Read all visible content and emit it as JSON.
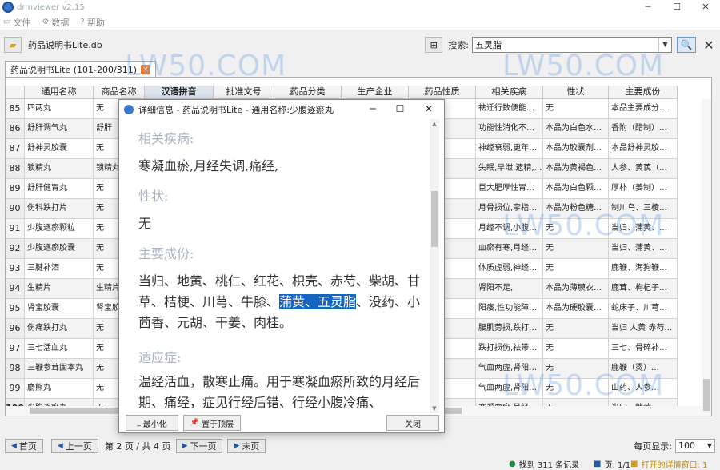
{
  "window": {
    "title": "drmviewer v2.15",
    "minimize": "─",
    "maximize": "☐",
    "close": "✕"
  },
  "menu": [
    {
      "label": "文件",
      "icon": "file-icon"
    },
    {
      "label": "数据",
      "icon": "gear-icon"
    },
    {
      "label": "帮助",
      "icon": "help-icon"
    }
  ],
  "toolbar": {
    "db_name": "药品说明书Lite.db",
    "search_label": "搜索:",
    "search_value": "五灵脂"
  },
  "tab": {
    "label": "药品说明书Lite (101-200/311)",
    "close": "×"
  },
  "watermark": "LW50.COM",
  "grid": {
    "headers": [
      "",
      "通用名称",
      "商品名称",
      "汉语拼音",
      "批准文号",
      "药品分类",
      "生产企业",
      "药品性质",
      "相关疾病",
      "性状",
      "主要成份"
    ],
    "rows": [
      [
        "85",
        "四两丸",
        "无",
        "",
        "",
        "",
        "",
        "方药",
        "祛迁行数便能…",
        "无",
        "本品主要成分…"
      ],
      [
        "86",
        "舒肝调气丸",
        "舒肝",
        "",
        "",
        "",
        "",
        "C甲类",
        "功能性消化不…",
        "本品为白色水…",
        "香附（醋制）…"
      ],
      [
        "87",
        "舒神灵胶囊",
        "无",
        "",
        "",
        "",
        "",
        "C甲类",
        "神经衰弱,更年…",
        "本品为胶囊剂…",
        "本品舒神灵胶…"
      ],
      [
        "88",
        "锁精丸",
        "锁精丸",
        "",
        "",
        "",
        "",
        "C甲类",
        "失眠,早泄,遗精,…",
        "本品为黄褐色…",
        "人参、黄芪（…"
      ],
      [
        "89",
        "舒肝健胃丸",
        "无",
        "",
        "",
        "",
        "",
        "C甲类",
        "巨大肥厚性胃…",
        "本品为白色颗…",
        "厚朴（姜制）…"
      ],
      [
        "90",
        "伤科跌打片",
        "无",
        "",
        "",
        "",
        "",
        "方药",
        "月骨损位,挛指…",
        "本品为粉色糖…",
        "制川乌、三棱…"
      ],
      [
        "91",
        "少腹逐瘀颗粒",
        "无",
        "",
        "",
        "",
        "",
        "方药",
        "月经不调,小腹…",
        "无",
        "当归、蒲黄、…"
      ],
      [
        "92",
        "少腹逐瘀胶囊",
        "无",
        "",
        "",
        "",
        "",
        "方药",
        "血瘀有寒,月经…",
        "无",
        "当归、蒲黄、…"
      ],
      [
        "93",
        "三腱补酒",
        "无",
        "",
        "",
        "",
        "",
        "C甲类",
        "体质虚弱,神经…",
        "无",
        "鹿鞭、海狗鞭…"
      ],
      [
        "94",
        "生精片",
        "生精片",
        "",
        "",
        "",
        "",
        "C甲类",
        "肾阳不足,",
        "本品为薄膜衣…",
        "鹿茸、枸杞子…"
      ],
      [
        "95",
        "肾宝胶囊",
        "肾宝胶",
        "",
        "",
        "",
        "",
        "方药",
        "阳痿,性功能障…",
        "本品为硬胶囊…",
        "蛇床子、川芎…"
      ],
      [
        "96",
        "伤痛跌打丸",
        "无",
        "",
        "",
        "",
        "",
        "C甲类",
        "腰肌劳损,跌打…",
        "无",
        "当归 人黄 赤芍…"
      ],
      [
        "97",
        "三七活血丸",
        "无",
        "",
        "",
        "",
        "",
        "C甲类",
        "跌打损伤,祛带…",
        "无",
        "三七、骨碎补…"
      ],
      [
        "98",
        "三鞭参茸固本丸",
        "无",
        "",
        "",
        "",
        "",
        "C甲类",
        "气血两虚,肾阳…",
        "无",
        "鹿鞭（烫）…"
      ],
      [
        "99",
        "麝熊丸",
        "无",
        "",
        "",
        "",
        "",
        "C甲类",
        "气血两虚,肾阳…",
        "无",
        "山药、人参…"
      ],
      [
        "100",
        "少腹逐瘀丸",
        "无",
        "",
        "",
        "",
        "",
        "C甲类",
        "寒凝血瘀,月经…",
        "无",
        "当归、地黄、…"
      ]
    ]
  },
  "pager": {
    "first": "首页",
    "prev": "上一页",
    "info": "第 2 页 / 共 4 页",
    "next": "下一页",
    "last": "末页",
    "per_page_label": "每页显示:",
    "per_page": "100"
  },
  "status": {
    "found": "找到 311 条记录",
    "page": "页: 1/1",
    "window": "打开的详情窗口: 1"
  },
  "dialog": {
    "title": "详细信息 - 药品说明书Lite - 通用名称:少腹逐瘀丸",
    "sections": [
      {
        "label": "相关疾病:",
        "text_before": "寒凝血瘀,月经失调,痛经,",
        "highlight": "",
        "text_after": ""
      },
      {
        "label": "性状:",
        "text_before": "无",
        "highlight": "",
        "text_after": ""
      },
      {
        "label": "主要成份:",
        "text_before": "当归、地黄、桃仁、红花、枳壳、赤芍、柴胡、甘草、桔梗、川芎、牛膝、",
        "highlight": "蒲黄、五灵脂",
        "text_after": "、没药、小茴香、元胡、干姜、肉桂。"
      },
      {
        "label": "适应症:",
        "text_before": "温经活血，散寒止痛。用于寒凝血瘀所致的月经后期、痛经，症见行经后错、行经小腹冷痛、",
        "highlight": "",
        "text_after": ""
      }
    ],
    "btn_minimize": "最小化",
    "btn_ontop": "置于顶层",
    "btn_close": "关闭"
  }
}
